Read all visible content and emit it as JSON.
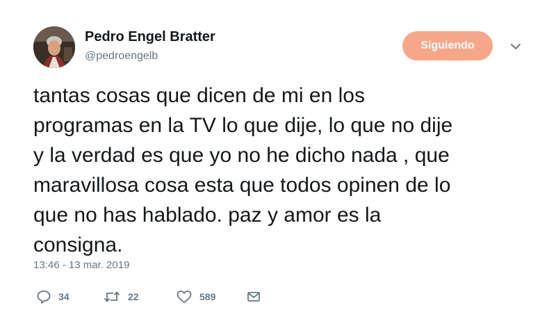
{
  "user": {
    "display_name": "Pedro Engel Bratter",
    "handle": "@pedroengelb",
    "avatar_icon": "profile-photo"
  },
  "follow_button": {
    "label": "Siguiendo",
    "color": "#f6a78a"
  },
  "menu_icon": "chevron-down-icon",
  "tweet": {
    "text": "tantas cosas que dicen de mi en los\nprogramas en la TV lo que dije, lo que no dije\ny la verdad es que yo no he dicho nada , que\nmaravillosa cosa esta que todos opinen de lo\nque no has hablado. paz y amor es la\nconsigna.",
    "timestamp": "13:46 - 13 mar. 2019"
  },
  "actions": {
    "replies": "34",
    "retweets": "22",
    "likes": "589",
    "reply_icon": "reply-icon",
    "retweet_icon": "retweet-icon",
    "like_icon": "heart-icon",
    "dm_icon": "envelope-icon"
  },
  "colors": {
    "text": "#14171a",
    "secondary": "#657786",
    "accent": "#f6a78a"
  }
}
